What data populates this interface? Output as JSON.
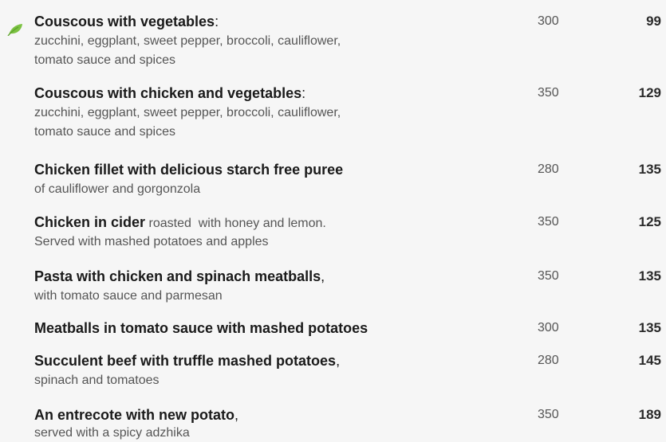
{
  "colors": {
    "leaf": "#7cc242",
    "title": "#1a1a1a",
    "description": "#555555",
    "background": "#f6f6f6"
  },
  "items": [
    {
      "icon": "leaf-icon",
      "name": "Couscous with vegetables",
      "suffix": ":",
      "inline_desc": "",
      "description": "zucchini, eggplant, sweet pepper, broccoli, cauliflower, tomato sauce and spices",
      "weight": "300",
      "price": "99"
    },
    {
      "name": "Couscous with chicken and vegetables",
      "suffix": ":",
      "inline_desc": "",
      "description": "zucchini, eggplant, sweet pepper, broccoli, cauliflower, tomato sauce and spices",
      "weight": "350",
      "price": "129"
    },
    {
      "name": "Chicken fillet with delicious starch free puree",
      "suffix": "",
      "inline_desc": "",
      "description": "of cauliflower and gorgonzola",
      "weight": "280",
      "price": "135"
    },
    {
      "name": "Chicken in cider",
      "suffix": "",
      "inline_desc": " roasted  with honey and lemon.",
      "description": "Served with mashed potatoes and apples",
      "weight": "350",
      "price": "125"
    },
    {
      "name": "Pasta with chicken and spinach meatballs",
      "suffix": ",",
      "inline_desc": "",
      "description": "with tomato sauce and parmesan",
      "weight": "350",
      "price": "135"
    },
    {
      "name": "Meatballs in tomato sauce with mashed potatoes",
      "suffix": "",
      "inline_desc": "",
      "description": "",
      "weight": "300",
      "price": "135"
    },
    {
      "name": "Succulent beef with truffle mashed potatoes",
      "suffix": ",",
      "inline_desc": "",
      "description": "spinach and tomatoes",
      "weight": "280",
      "price": "145"
    },
    {
      "name": "An entrecote with new potato",
      "suffix": ",",
      "inline_desc": "",
      "description": "served with a spicy adzhika",
      "weight": "350",
      "price": "189"
    }
  ]
}
